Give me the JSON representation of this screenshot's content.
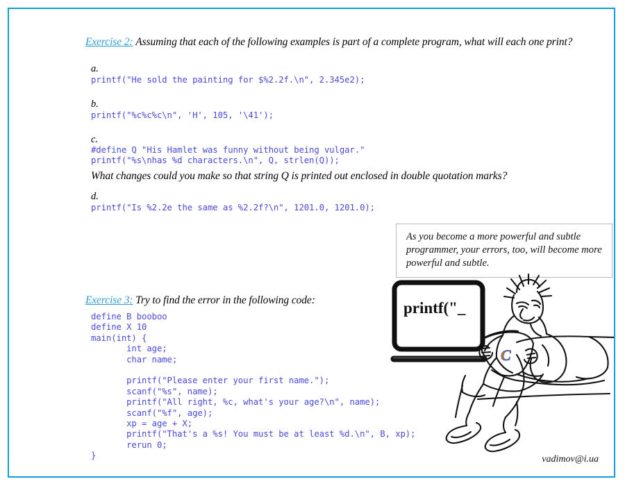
{
  "page": {
    "border_color": "#0d9ddb",
    "background": "#ffffff",
    "code_color": "#4a4ad6",
    "accent_color": "#2e9fd4"
  },
  "exercise2": {
    "label": "Exercise 2:",
    "prompt": "Assuming that each of the following examples is part of a complete program, what will each one print?",
    "items": [
      {
        "letter": "a.",
        "code": "printf(\"He sold the painting for $%2.2f.\\n\", 2.345e2);"
      },
      {
        "letter": "b.",
        "code": "printf(\"%c%c%c\\n\", 'H', 105, '\\41');"
      },
      {
        "letter": "c.",
        "code": "#define Q \"His Hamlet was funny without being vulgar.\"\nprintf(\"%s\\nhas %d characters.\\n\", Q, strlen(Q));"
      },
      {
        "letter": "d.",
        "code": "printf(\"Is %2.2e the same as %2.2f?\\n\", 1201.0, 1201.0);"
      }
    ],
    "followup_question": "What changes could you make so that string Q is printed out enclosed in double quotation marks?"
  },
  "quote": {
    "text": "As you become a more powerful and subtle programmer, your errors, too, will become more powerful and subtle."
  },
  "exercise3": {
    "label": "Exercise 3:",
    "prompt": "Try to find the error in the following code:",
    "code": "define B booboo\ndefine X 10\nmain(int) {\n       int age;\n       char name;\n\n       printf(\"Please enter your first name.\");\n       scanf(\"%s\", name);\n       printf(\"All right, %c, what's your age?\\n\", name);\n       scanf(\"%f\", age);\n       xp = age + X;\n       printf(\"That's a %s! You must be at least %d.\\n\", B, xp);\n       rerun 0;\n}"
  },
  "illustration": {
    "laptop_screen_text": "printf(\"_",
    "book_letter": "C"
  },
  "footer": {
    "email": "vadimov@i.ua"
  }
}
